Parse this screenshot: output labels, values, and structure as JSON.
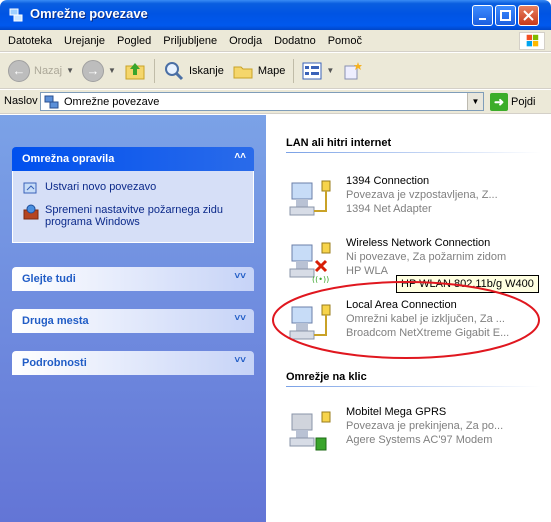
{
  "window": {
    "title": "Omrežne povezave"
  },
  "menu": [
    "Datoteka",
    "Urejanje",
    "Pogled",
    "Priljubljene",
    "Orodja",
    "Dodatno",
    "Pomoč"
  ],
  "toolbar": {
    "back": "Nazaj",
    "search": "Iskanje",
    "folders": "Mape"
  },
  "address": {
    "label": "Naslov",
    "value": "Omrežne povezave",
    "go": "Pojdi"
  },
  "left": {
    "tasks_title": "Omrežna opravila",
    "tasks": [
      "Ustvari novo povezavo",
      "Spremeni nastavitve požarnega zidu programa Windows"
    ],
    "see_also": "Glejte tudi",
    "other_places": "Druga mesta",
    "details": "Podrobnosti"
  },
  "groups": {
    "lan_title": "LAN ali hitri internet",
    "dialup_title": "Omrežje na klic"
  },
  "connections": [
    {
      "name": "1394 Connection",
      "status": "Povezava je vzpostavljena, Z...",
      "device": "1394 Net Adapter"
    },
    {
      "name": "Wireless Network Connection",
      "status": "Ni povezave, Za požarnim zidom",
      "device": "HP WLA"
    },
    {
      "name": "Local Area Connection",
      "status": "Omrežni kabel je izključen, Za ...",
      "device": "Broadcom NetXtreme Gigabit E..."
    },
    {
      "name": "Mobitel Mega GPRS",
      "status": "Povezava je prekinjena, Za po...",
      "device": "Agere Systems AC'97 Modem"
    }
  ],
  "tooltip": "HP WLAN 802.11b/g W400",
  "colors": {
    "title_blue": "#0054e3",
    "left_pane": "#7ba2e7",
    "link_blue": "#215dc6",
    "annotation_red": "#e0171f"
  }
}
